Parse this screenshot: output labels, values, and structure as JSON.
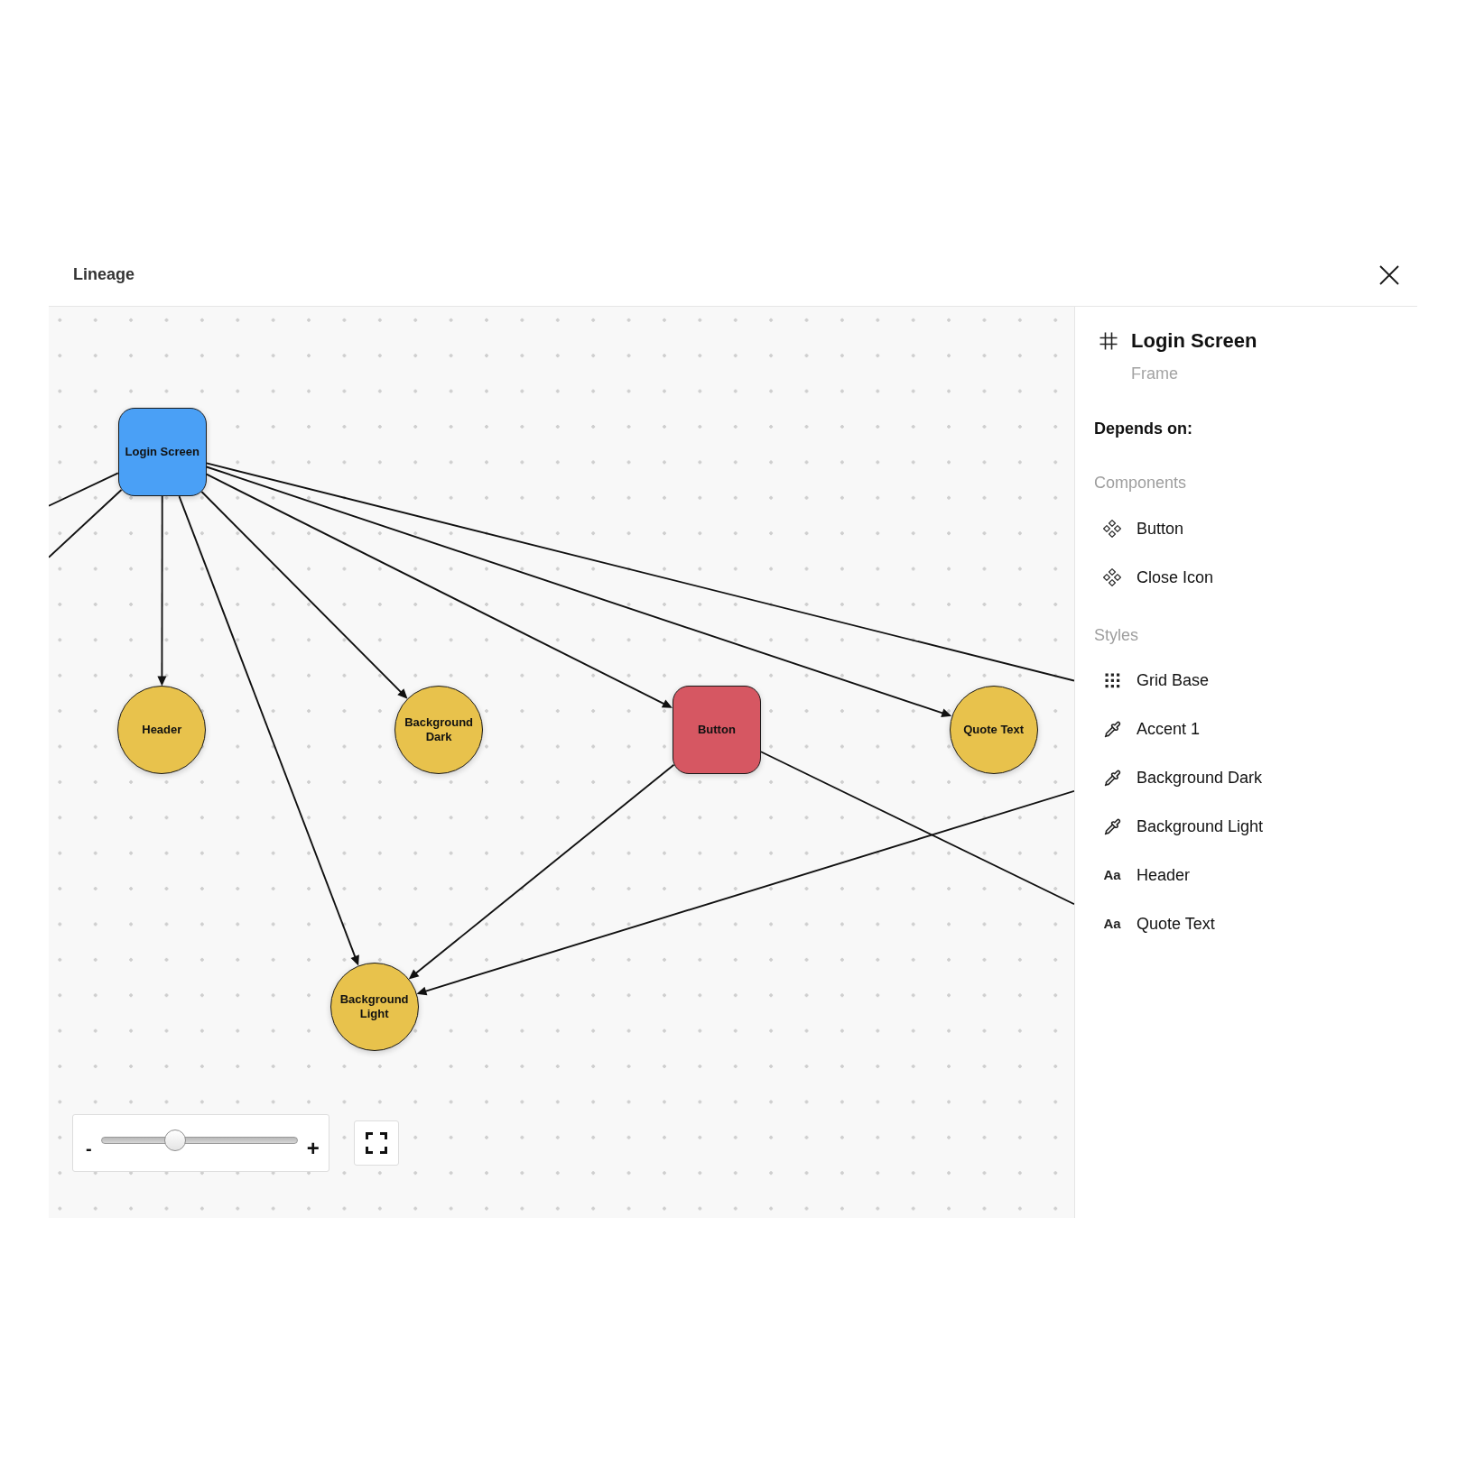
{
  "dialog": {
    "title": "Lineage"
  },
  "graph": {
    "nodes": [
      {
        "label": "Login Screen",
        "kind": "frame",
        "color": "#4aa0f6"
      },
      {
        "label": "Header",
        "kind": "style",
        "color": "#e8c24c"
      },
      {
        "label": "Background Dark",
        "kind": "style",
        "color": "#e8c24c"
      },
      {
        "label": "Button",
        "kind": "component",
        "color": "#d65762"
      },
      {
        "label": "Quote Text",
        "kind": "style",
        "color": "#e8c24c"
      },
      {
        "label": "Background Light",
        "kind": "style",
        "color": "#e8c24c"
      }
    ]
  },
  "zoom": {
    "zoom_out": "-",
    "zoom_in": "+",
    "level": 0.36
  },
  "details": {
    "title": "Login Screen",
    "subtitle": "Frame",
    "heading": "Depends on:",
    "groups": [
      {
        "label": "Components",
        "items": [
          {
            "label": "Button",
            "kind": "component"
          },
          {
            "label": "Close Icon",
            "kind": "component"
          }
        ]
      },
      {
        "label": "Styles",
        "items": [
          {
            "label": "Grid Base",
            "kind": "grid"
          },
          {
            "label": "Accent 1",
            "kind": "color"
          },
          {
            "label": "Background Dark",
            "kind": "color"
          },
          {
            "label": "Background Light",
            "kind": "color"
          },
          {
            "label": "Header",
            "kind": "text",
            "glyph": "Aa"
          },
          {
            "label": "Quote Text",
            "kind": "text",
            "glyph": "Aa"
          }
        ]
      }
    ]
  }
}
